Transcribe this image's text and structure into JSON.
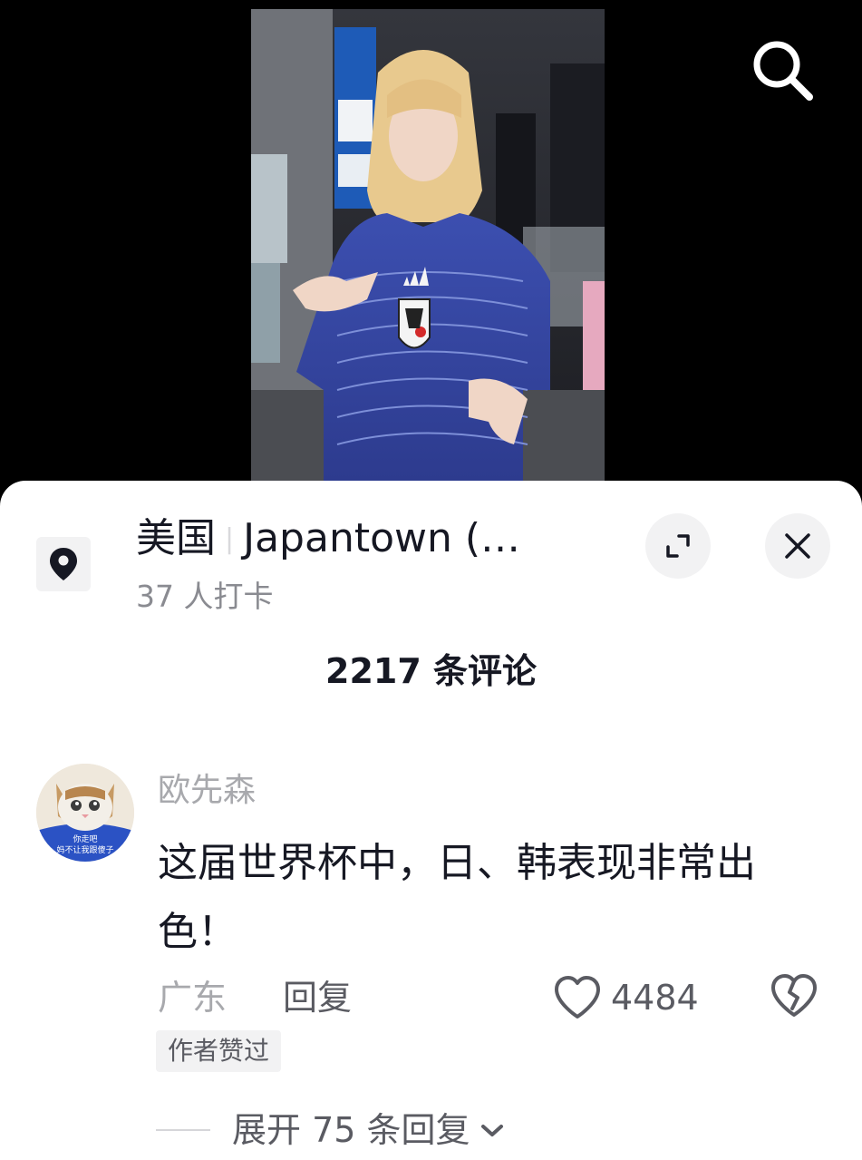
{
  "video": {
    "search_icon": "search-icon"
  },
  "location": {
    "country": "美国",
    "place": "Japantown (…",
    "checkins": "37 人打卡",
    "icon": "location-pin-icon"
  },
  "header_actions": {
    "expand_icon": "expand-icon",
    "close_icon": "close-icon"
  },
  "comments": {
    "count_label": "2217 条评论",
    "items": [
      {
        "username": "欧先森",
        "text": "这届世界杯中，日、韩表现非常出色！",
        "avatar_caption_line1": "你走吧",
        "avatar_caption_line2": "妈不让我跟傻子",
        "region": "广东",
        "reply_label": "回复",
        "likes": "4484",
        "badge": "作者赞过",
        "expand_replies_label": "展开 75 条回复"
      }
    ]
  },
  "colors": {
    "primary_text": "#161823",
    "secondary_text": "#a8a9ad",
    "action_text": "#5a5b62",
    "chip_bg": "#f2f2f3"
  }
}
